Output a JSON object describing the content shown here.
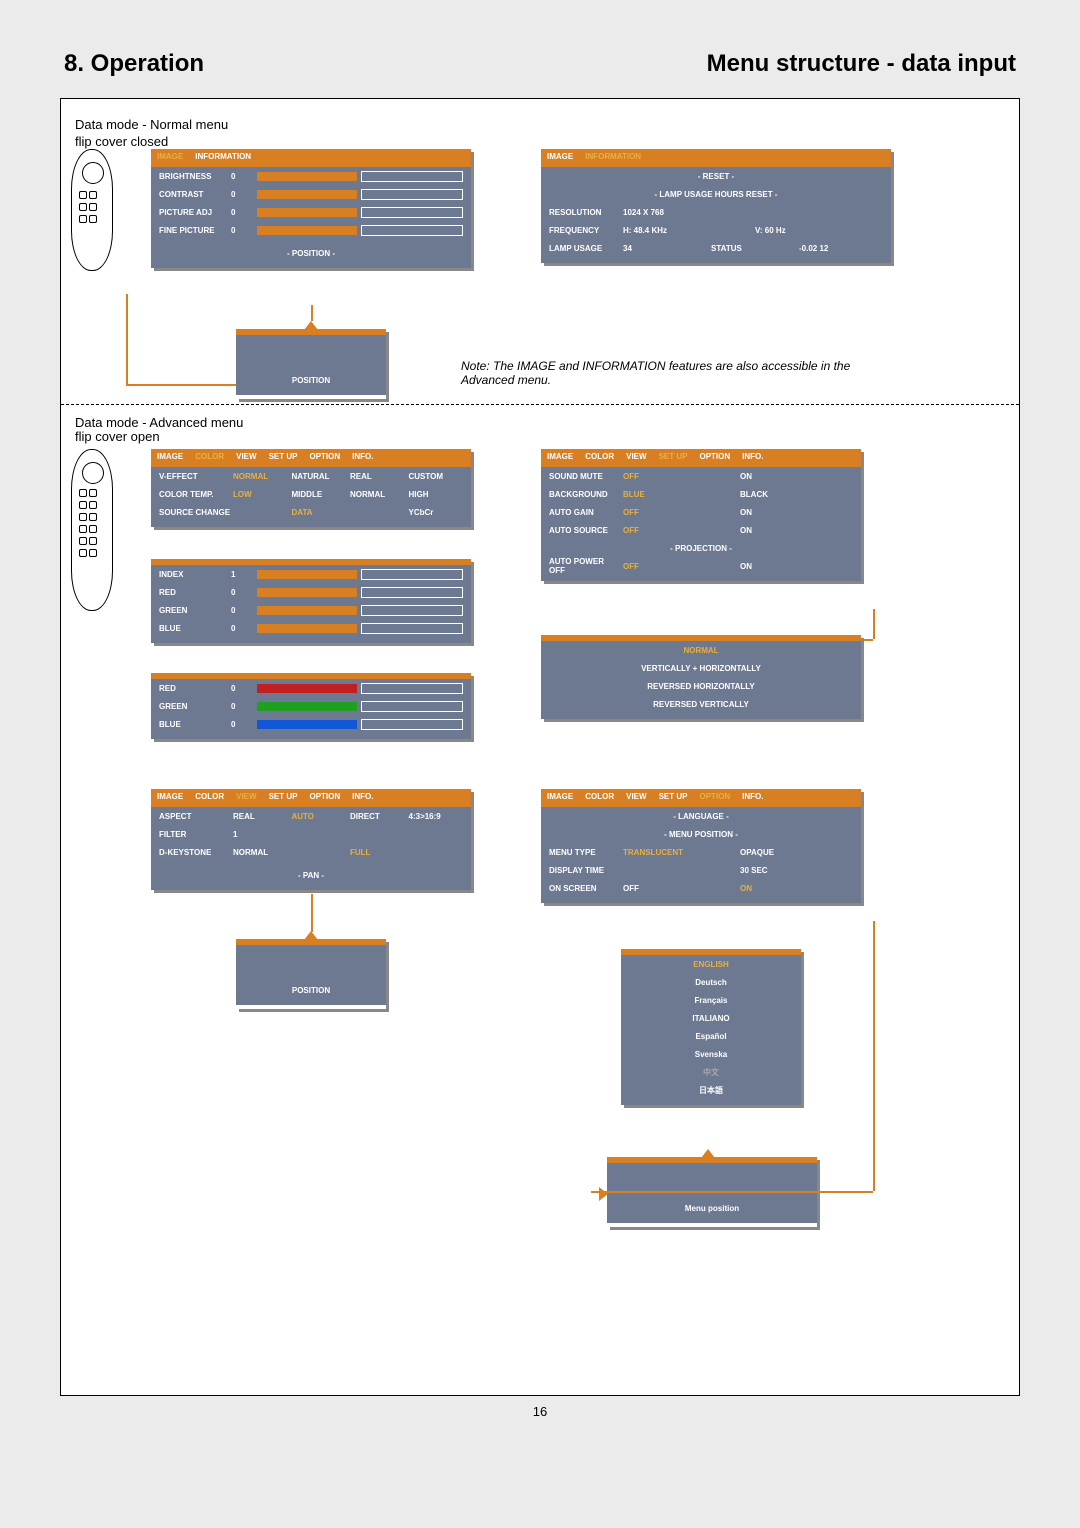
{
  "header": {
    "left": "8. Operation",
    "right": "Menu structure - data input"
  },
  "caption_normal_l1": "Data mode - Normal menu",
  "caption_normal_l2": "flip cover closed",
  "caption_adv_l1": "Data mode - Advanced menu",
  "caption_adv_l2": "flip cover open",
  "pagenum": "16",
  "note": "Note: The IMAGE and INFORMATION features are also accessible in the Advanced menu.",
  "p_image": {
    "tabs": [
      "IMAGE",
      "INFORMATION"
    ],
    "active": 0,
    "rows": [
      {
        "label": "BRIGHTNESS",
        "val": "0"
      },
      {
        "label": "CONTRAST",
        "val": "0"
      },
      {
        "label": "PICTURE ADJ",
        "val": "0"
      },
      {
        "label": "FINE PICTURE",
        "val": "0"
      }
    ],
    "footer": "- POSITION -"
  },
  "p_position": {
    "footer": "POSITION"
  },
  "p_info": {
    "tabs": [
      "IMAGE",
      "INFORMATION"
    ],
    "active": 1,
    "rows": [
      {
        "center": "- RESET -"
      },
      {
        "center": "- LAMP USAGE HOURS RESET -"
      },
      {
        "label": "RESOLUTION",
        "opts": [
          "1024  X  768"
        ]
      },
      {
        "label": "FREQUENCY",
        "opts": [
          "H: 48.4 KHz",
          "V: 60 Hz"
        ]
      },
      {
        "label": "LAMP USAGE",
        "opts": [
          "34",
          "STATUS",
          "-0.02  12"
        ]
      }
    ]
  },
  "p_color": {
    "tabs": [
      "IMAGE",
      "COLOR",
      "VIEW",
      "SET UP",
      "OPTION",
      "INFO."
    ],
    "active": 1,
    "rows": [
      {
        "label": "V-EFFECT",
        "opts": [
          "NORMAL",
          "NATURAL",
          "REAL",
          "CUSTOM"
        ],
        "hl": 0
      },
      {
        "label": "COLOR TEMP.",
        "opts": [
          "LOW",
          "MIDDLE",
          "NORMAL",
          "HIGH"
        ],
        "hl": 0
      },
      {
        "label": "SOURCE CHANGE",
        "opts": [
          "",
          "DATA",
          "",
          "YCbCr"
        ],
        "hl": 1
      }
    ]
  },
  "p_index": {
    "rows": [
      {
        "label": "INDEX",
        "val": "1"
      },
      {
        "label": "RED",
        "val": "0"
      },
      {
        "label": "GREEN",
        "val": "0"
      },
      {
        "label": "BLUE",
        "val": "0"
      }
    ]
  },
  "p_rgb": {
    "rows": [
      {
        "label": "RED",
        "val": "0",
        "bar": "red"
      },
      {
        "label": "GREEN",
        "val": "0",
        "bar": "green"
      },
      {
        "label": "BLUE",
        "val": "0",
        "bar": "blue"
      }
    ]
  },
  "p_view": {
    "tabs": [
      "IMAGE",
      "COLOR",
      "VIEW",
      "SET UP",
      "OPTION",
      "INFO."
    ],
    "active": 2,
    "rows": [
      {
        "label": "ASPECT",
        "opts": [
          "REAL",
          "AUTO",
          "DIRECT",
          "4:3>16:9"
        ],
        "hl": 1
      },
      {
        "label": "FILTER",
        "opts": [
          "1",
          "",
          "",
          ""
        ]
      },
      {
        "label": "D-KEYSTONE",
        "opts": [
          "NORMAL",
          "",
          "FULL",
          ""
        ],
        "hl": 2
      }
    ],
    "footer": "- PAN -"
  },
  "p_position2": {
    "footer": "POSITION"
  },
  "p_setup": {
    "tabs": [
      "IMAGE",
      "COLOR",
      "VIEW",
      "SET UP",
      "OPTION",
      "INFO."
    ],
    "active": 3,
    "rows": [
      {
        "label": "SOUND MUTE",
        "opts": [
          "OFF",
          "ON"
        ],
        "hl": 0
      },
      {
        "label": "BACKGROUND",
        "opts": [
          "BLUE",
          "BLACK"
        ],
        "hl": 0
      },
      {
        "label": "AUTO GAIN",
        "opts": [
          "OFF",
          "ON"
        ],
        "hl": 0
      },
      {
        "label": "AUTO SOURCE",
        "opts": [
          "OFF",
          "ON"
        ],
        "hl": 0
      },
      {
        "center": "- PROJECTION -"
      },
      {
        "label": "AUTO POWER OFF",
        "opts": [
          "OFF",
          "ON"
        ],
        "hl": 0
      }
    ]
  },
  "p_proj": {
    "rows": [
      {
        "center": "NORMAL",
        "hl": true
      },
      {
        "center": "VERTICALLY + HORIZONTALLY"
      },
      {
        "center": "REVERSED HORIZONTALLY"
      },
      {
        "center": "REVERSED VERTICALLY"
      }
    ]
  },
  "p_option": {
    "tabs": [
      "IMAGE",
      "COLOR",
      "VIEW",
      "SET UP",
      "OPTION",
      "INFO."
    ],
    "active": 4,
    "rows": [
      {
        "center": "- LANGUAGE -"
      },
      {
        "center": "- MENU POSITION -"
      },
      {
        "label": "MENU TYPE",
        "opts": [
          "TRANSLUCENT",
          "OPAQUE"
        ],
        "hl": 0
      },
      {
        "label": "DISPLAY TIME",
        "opts": [
          "",
          "30 SEC"
        ]
      },
      {
        "label": "ON SCREEN",
        "opts": [
          "OFF",
          "ON"
        ],
        "hl": 1
      }
    ]
  },
  "p_lang": {
    "rows": [
      {
        "center": "ENGLISH",
        "hl": true
      },
      {
        "center": "Deutsch"
      },
      {
        "center": "Français"
      },
      {
        "center": "ITALIANO"
      },
      {
        "center": "Español"
      },
      {
        "center": "Svenska"
      },
      {
        "center": "中文",
        "dim": true
      },
      {
        "center": "日本語"
      }
    ]
  },
  "p_menupos": {
    "footer": "Menu position"
  }
}
